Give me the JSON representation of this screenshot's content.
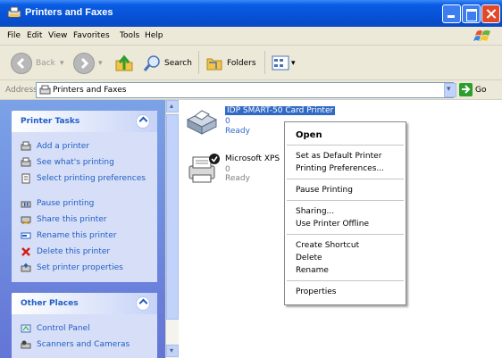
{
  "window": {
    "title": "Printers and Faxes"
  },
  "menu": [
    "File",
    "Edit",
    "View",
    "Favorites",
    "Tools",
    "Help"
  ],
  "toolbar": {
    "back": "Back",
    "search": "Search",
    "folders": "Folders"
  },
  "address": {
    "label": "Address",
    "value": "Printers and Faxes",
    "go": "Go"
  },
  "printer_tasks": {
    "title": "Printer Tasks",
    "items": [
      "Add a printer",
      "See what's printing",
      "Select printing preferences",
      "Pause printing",
      "Share this printer",
      "Rename this printer",
      "Delete this printer",
      "Set printer properties"
    ]
  },
  "other_places": {
    "title": "Other Places",
    "items": [
      "Control Panel",
      "Scanners and Cameras"
    ]
  },
  "printers": [
    {
      "name": "IDP SMART-50 Card Printer",
      "docs": "0",
      "status": "Ready"
    },
    {
      "name": "Microsoft XPS",
      "docs": "0",
      "status": "Ready"
    }
  ],
  "context_menu": {
    "open": "Open",
    "set_default": "Set as Default Printer",
    "prefs": "Printing Preferences...",
    "pause": "Pause Printing",
    "sharing": "Sharing...",
    "offline": "Use Printer Offline",
    "shortcut": "Create Shortcut",
    "delete": "Delete",
    "rename": "Rename",
    "properties": "Properties"
  }
}
